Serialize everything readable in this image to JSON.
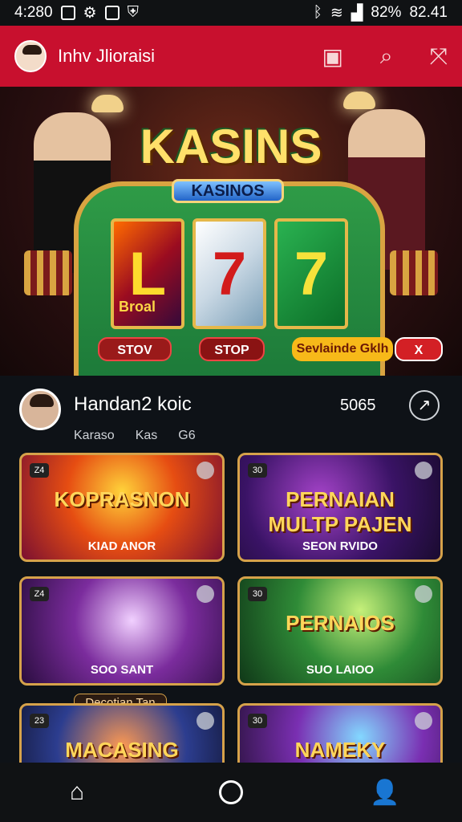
{
  "status": {
    "time": "4:280",
    "battery": "82%",
    "clock": "82.41"
  },
  "topbar": {
    "title": "Inhv Jlioraisi"
  },
  "hero": {
    "title": "KASINS",
    "subtitle": "KASINOS",
    "reel_1": "L",
    "reel_2": "7",
    "reel_3": "7",
    "reel_caption": "Broal",
    "buttons": {
      "stop_left": "STOV",
      "stop_mid": "STOP",
      "cta": "Sevlainde Gklh",
      "close": "X"
    }
  },
  "profile": {
    "name": "Handan2 koic",
    "count": "5065",
    "tabs": [
      "Karaso",
      "Kas",
      "G6"
    ]
  },
  "cards": [
    {
      "title": "KOPRASNON",
      "label": "KIAD ANOR",
      "badge": "Z4"
    },
    {
      "title": "PERNAIAN MULTP PAJEN",
      "label": "SEON RVIDO",
      "badge": "30"
    },
    {
      "title": "",
      "label": "SOO SANT",
      "badge": "Z4"
    },
    {
      "title": "PERNAIOS",
      "label": "SUO LAIOO",
      "badge": "30"
    },
    {
      "title": "MACASING",
      "label": "",
      "badge": "23"
    },
    {
      "title": "NAMEKY",
      "label": "",
      "badge": "30"
    }
  ],
  "promo": "Decotian Tan"
}
